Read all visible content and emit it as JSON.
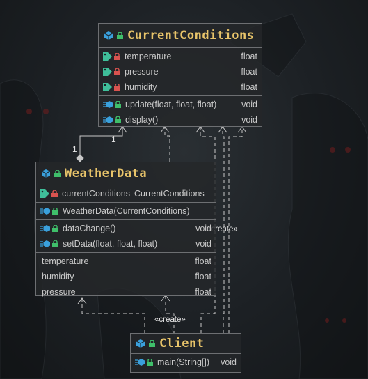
{
  "diagram": {
    "classes": {
      "current_conditions": {
        "title": "CurrentConditions",
        "fields": [
          {
            "name": "temperature",
            "type": "float"
          },
          {
            "name": "pressure",
            "type": "float"
          },
          {
            "name": "humidity",
            "type": "float"
          }
        ],
        "methods": [
          {
            "name": "update(float, float, float)",
            "type": "void"
          },
          {
            "name": "display()",
            "type": "void"
          }
        ]
      },
      "weather_data": {
        "title": "WeatherData",
        "fields": [
          {
            "name": "currentConditions",
            "type": "CurrentConditions"
          }
        ],
        "constructors": [
          {
            "name": "WeatherData(CurrentConditions)"
          }
        ],
        "methods": [
          {
            "name": "dataChange()",
            "type": "void"
          },
          {
            "name": "setData(float, float, float)",
            "type": "void"
          }
        ],
        "properties": [
          {
            "name": "temperature",
            "type": "float"
          },
          {
            "name": "humidity",
            "type": "float"
          },
          {
            "name": "pressure",
            "type": "float"
          }
        ]
      },
      "client": {
        "title": "Client",
        "methods": [
          {
            "name": "main(String[])",
            "type": "void"
          }
        ]
      }
    },
    "labels": {
      "create_right": "«create»",
      "create_bottom": "«create»",
      "multiplicity_source": "1",
      "multiplicity_target": "1"
    }
  },
  "colors": {
    "class_title": "#e8c46a",
    "class_icon": "#3aa0dc",
    "lock_icon": "#3fbf6a",
    "field_icon": "#3fbf9a",
    "private_lock": "#d9534f",
    "edge": "#c8c8c8"
  }
}
